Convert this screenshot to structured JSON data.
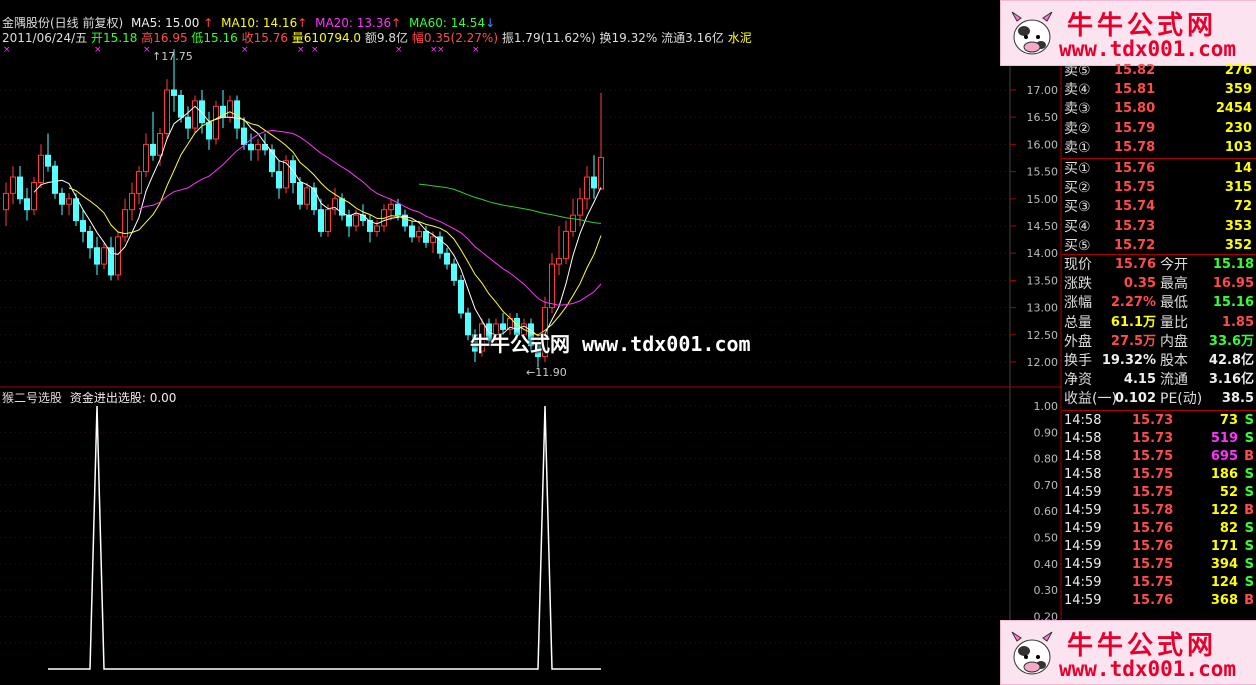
{
  "title_line": {
    "stock": "金隅股份(日线 前复权)",
    "ma5": "MA5: 15.00",
    "ma10": "MA10: 14.16",
    "ma20": "MA20: 13.36",
    "ma60": "MA60: 14.54",
    "ma5_arrow": "↑",
    "ma10_arrow": "↑",
    "ma20_arrow": "↑",
    "ma60_arrow": "↓"
  },
  "info_line": {
    "date": "2011/06/24/五",
    "open": "开15.18",
    "high": "高16.95",
    "low": "低15.16",
    "close": "收15.76",
    "volume": "量610794.0",
    "amount": "额9.8亿",
    "change": "幅0.35(2.27%)",
    "amplitude": "振1.79(11.62%)",
    "turnover": "换19.32%",
    "float": "流通3.16亿",
    "sector": "水泥"
  },
  "annotations": {
    "high_mark": "17.75",
    "low_mark": "←11.90"
  },
  "price_axis": [
    "17.00",
    "16.50",
    "16.00",
    "15.50",
    "15.00",
    "14.50",
    "14.00",
    "13.50",
    "13.00",
    "12.50",
    "12.00"
  ],
  "indicator": {
    "title": "猴二号选股",
    "signal": "资金进出选股: 0.00",
    "axis": [
      "1.00",
      "0.90",
      "0.80",
      "0.70",
      "0.60",
      "0.50",
      "0.40",
      "0.30",
      "0.20",
      "0.10"
    ]
  },
  "order_book": {
    "asks": [
      {
        "label": "卖⑤",
        "price": "15.82",
        "vol": "276"
      },
      {
        "label": "卖④",
        "price": "15.81",
        "vol": "359"
      },
      {
        "label": "卖③",
        "price": "15.80",
        "vol": "2454"
      },
      {
        "label": "卖②",
        "price": "15.79",
        "vol": "230"
      },
      {
        "label": "卖①",
        "price": "15.78",
        "vol": "103"
      }
    ],
    "bids": [
      {
        "label": "买①",
        "price": "15.76",
        "vol": "14"
      },
      {
        "label": "买②",
        "price": "15.75",
        "vol": "315"
      },
      {
        "label": "买③",
        "price": "15.74",
        "vol": "72"
      },
      {
        "label": "买④",
        "price": "15.73",
        "vol": "353"
      },
      {
        "label": "买⑤",
        "price": "15.72",
        "vol": "352"
      }
    ]
  },
  "quote": [
    {
      "l1": "现价",
      "v1": "15.76",
      "c1": "red",
      "l2": "今开",
      "v2": "15.18",
      "c2": "grn"
    },
    {
      "l1": "涨跌",
      "v1": "0.35",
      "c1": "red",
      "l2": "最高",
      "v2": "16.95",
      "c2": "red"
    },
    {
      "l1": "涨幅",
      "v1": "2.27%",
      "c1": "red",
      "l2": "最低",
      "v2": "15.16",
      "c2": "grn"
    },
    {
      "l1": "总量",
      "v1": "61.1万",
      "c1": "yel",
      "l2": "量比",
      "v2": "1.85",
      "c2": "red"
    },
    {
      "l1": "外盘",
      "v1": "27.5万",
      "c1": "red",
      "l2": "内盘",
      "v2": "33.6万",
      "c2": "grn"
    },
    {
      "l1": "换手",
      "v1": "19.32%",
      "c1": "wht",
      "l2": "股本",
      "v2": "42.8亿",
      "c2": "wht"
    },
    {
      "l1": "净资",
      "v1": "4.15",
      "c1": "wht",
      "l2": "流通",
      "v2": "3.16亿",
      "c2": "wht"
    },
    {
      "l1": "收益(一)",
      "v1": "0.102",
      "c1": "wht",
      "l2": "PE(动)",
      "v2": "38.5",
      "c2": "wht"
    }
  ],
  "ticks": [
    {
      "time": "14:58",
      "price": "15.73",
      "pc": "red",
      "vol": "73",
      "vc": "yel",
      "flag": "S",
      "fc": "grn"
    },
    {
      "time": "14:58",
      "price": "15.73",
      "pc": "red",
      "vol": "519",
      "vc": "mag",
      "flag": "S",
      "fc": "grn"
    },
    {
      "time": "14:58",
      "price": "15.75",
      "pc": "red",
      "vol": "695",
      "vc": "mag",
      "flag": "B",
      "fc": "red"
    },
    {
      "time": "14:58",
      "price": "15.75",
      "pc": "red",
      "vol": "186",
      "vc": "yel",
      "flag": "S",
      "fc": "grn"
    },
    {
      "time": "14:59",
      "price": "15.75",
      "pc": "red",
      "vol": "52",
      "vc": "yel",
      "flag": "S",
      "fc": "grn"
    },
    {
      "time": "14:59",
      "price": "15.78",
      "pc": "red",
      "vol": "122",
      "vc": "yel",
      "flag": "B",
      "fc": "red"
    },
    {
      "time": "14:59",
      "price": "15.76",
      "pc": "red",
      "vol": "82",
      "vc": "yel",
      "flag": "S",
      "fc": "grn"
    },
    {
      "time": "14:59",
      "price": "15.76",
      "pc": "red",
      "vol": "171",
      "vc": "yel",
      "flag": "S",
      "fc": "grn"
    },
    {
      "time": "14:59",
      "price": "15.75",
      "pc": "red",
      "vol": "394",
      "vc": "yel",
      "flag": "S",
      "fc": "grn"
    },
    {
      "time": "14:59",
      "price": "15.75",
      "pc": "red",
      "vol": "124",
      "vc": "yel",
      "flag": "S",
      "fc": "grn"
    },
    {
      "time": "14:59",
      "price": "15.76",
      "pc": "red",
      "vol": "368",
      "vc": "yel",
      "flag": "B",
      "fc": "red"
    }
  ],
  "watermark": {
    "name": "牛牛公式网",
    "url": "www.tdx001.com",
    "center_name": "牛牛公式网",
    "center_url": "www.tdx001.com"
  },
  "chart_data": {
    "type": "candlestick",
    "candles": [
      [
        14.8,
        15.3,
        14.5,
        15.1
      ],
      [
        15.1,
        15.6,
        14.9,
        15.4
      ],
      [
        15.4,
        15.6,
        14.9,
        15.0
      ],
      [
        15.0,
        15.2,
        14.6,
        14.8
      ],
      [
        14.8,
        15.4,
        14.7,
        15.3
      ],
      [
        15.3,
        16.0,
        15.2,
        15.8
      ],
      [
        15.8,
        16.2,
        15.5,
        15.6
      ],
      [
        15.6,
        15.7,
        15.0,
        15.1
      ],
      [
        15.1,
        15.2,
        14.7,
        14.9
      ],
      [
        14.9,
        15.1,
        14.7,
        15.0
      ],
      [
        15.0,
        15.1,
        14.5,
        14.6
      ],
      [
        14.6,
        14.8,
        14.2,
        14.4
      ],
      [
        14.4,
        14.5,
        13.9,
        14.1
      ],
      [
        14.1,
        14.3,
        13.6,
        13.8
      ],
      [
        13.8,
        14.2,
        13.7,
        14.1
      ],
      [
        14.1,
        14.3,
        13.5,
        13.6
      ],
      [
        13.6,
        14.4,
        13.5,
        14.3
      ],
      [
        14.3,
        15.0,
        14.2,
        14.8
      ],
      [
        14.8,
        15.3,
        14.6,
        15.1
      ],
      [
        15.1,
        15.6,
        14.9,
        15.5
      ],
      [
        15.5,
        16.2,
        15.4,
        16.0
      ],
      [
        16.0,
        16.6,
        15.7,
        15.8
      ],
      [
        15.8,
        16.3,
        15.6,
        16.2
      ],
      [
        16.2,
        17.2,
        16.1,
        17.0
      ],
      [
        17.0,
        17.75,
        16.6,
        16.9
      ],
      [
        16.9,
        17.0,
        16.4,
        16.5
      ],
      [
        16.5,
        16.7,
        16.1,
        16.3
      ],
      [
        16.3,
        16.9,
        16.2,
        16.8
      ],
      [
        16.8,
        17.0,
        16.2,
        16.4
      ],
      [
        16.4,
        16.6,
        15.9,
        16.1
      ],
      [
        16.1,
        16.8,
        16.0,
        16.7
      ],
      [
        16.7,
        17.0,
        16.3,
        16.5
      ],
      [
        16.5,
        16.9,
        16.4,
        16.8
      ],
      [
        16.8,
        16.9,
        16.1,
        16.3
      ],
      [
        16.3,
        16.5,
        15.9,
        16.0
      ],
      [
        16.0,
        16.2,
        15.7,
        15.9
      ],
      [
        15.9,
        16.1,
        15.7,
        16.0
      ],
      [
        16.0,
        16.2,
        15.8,
        15.9
      ],
      [
        15.9,
        16.0,
        15.4,
        15.5
      ],
      [
        15.5,
        15.7,
        15.0,
        15.2
      ],
      [
        15.2,
        15.8,
        15.1,
        15.7
      ],
      [
        15.7,
        15.8,
        15.1,
        15.3
      ],
      [
        15.3,
        15.4,
        14.8,
        14.9
      ],
      [
        14.9,
        15.3,
        14.8,
        15.2
      ],
      [
        15.2,
        15.3,
        14.7,
        14.8
      ],
      [
        14.8,
        15.0,
        14.3,
        14.4
      ],
      [
        14.4,
        14.9,
        14.3,
        14.8
      ],
      [
        14.8,
        15.2,
        14.7,
        15.0
      ],
      [
        15.0,
        15.1,
        14.6,
        14.7
      ],
      [
        14.7,
        14.8,
        14.3,
        14.5
      ],
      [
        14.5,
        14.8,
        14.4,
        14.7
      ],
      [
        14.7,
        14.9,
        14.5,
        14.6
      ],
      [
        14.6,
        14.7,
        14.2,
        14.4
      ],
      [
        14.4,
        14.6,
        14.3,
        14.5
      ],
      [
        14.5,
        14.9,
        14.4,
        14.8
      ],
      [
        14.8,
        15.0,
        14.6,
        14.9
      ],
      [
        14.9,
        15.0,
        14.6,
        14.7
      ],
      [
        14.7,
        14.8,
        14.4,
        14.5
      ],
      [
        14.5,
        14.6,
        14.2,
        14.3
      ],
      [
        14.3,
        14.5,
        14.2,
        14.4
      ],
      [
        14.4,
        14.5,
        14.1,
        14.2
      ],
      [
        14.2,
        14.4,
        14.0,
        14.3
      ],
      [
        14.3,
        14.4,
        13.9,
        14.0
      ],
      [
        14.0,
        14.1,
        13.7,
        13.8
      ],
      [
        13.8,
        13.9,
        13.4,
        13.5
      ],
      [
        13.5,
        13.6,
        12.8,
        12.9
      ],
      [
        12.9,
        13.0,
        12.4,
        12.5
      ],
      [
        12.5,
        12.6,
        12.0,
        12.2
      ],
      [
        12.2,
        12.8,
        12.1,
        12.7
      ],
      [
        12.7,
        12.8,
        12.3,
        12.4
      ],
      [
        12.4,
        12.8,
        12.3,
        12.7
      ],
      [
        12.7,
        12.9,
        12.5,
        12.6
      ],
      [
        12.6,
        12.9,
        12.5,
        12.8
      ],
      [
        12.8,
        12.9,
        12.4,
        12.5
      ],
      [
        12.5,
        12.8,
        12.4,
        12.7
      ],
      [
        12.7,
        12.8,
        12.2,
        12.3
      ],
      [
        12.3,
        12.4,
        11.9,
        12.1
      ],
      [
        12.1,
        13.2,
        12.0,
        13.0
      ],
      [
        13.0,
        14.0,
        12.9,
        13.8
      ],
      [
        13.8,
        14.5,
        13.6,
        13.9
      ],
      [
        13.9,
        14.6,
        13.8,
        14.4
      ],
      [
        14.4,
        15.0,
        14.3,
        14.7
      ],
      [
        14.7,
        15.2,
        14.5,
        15.0
      ],
      [
        15.0,
        15.6,
        14.8,
        15.4
      ],
      [
        15.4,
        15.8,
        15.0,
        15.2
      ],
      [
        15.18,
        16.95,
        15.16,
        15.76
      ]
    ],
    "indicator_signal_positions": [
      13,
      77
    ],
    "ylim": [
      11.8,
      17.9
    ]
  }
}
